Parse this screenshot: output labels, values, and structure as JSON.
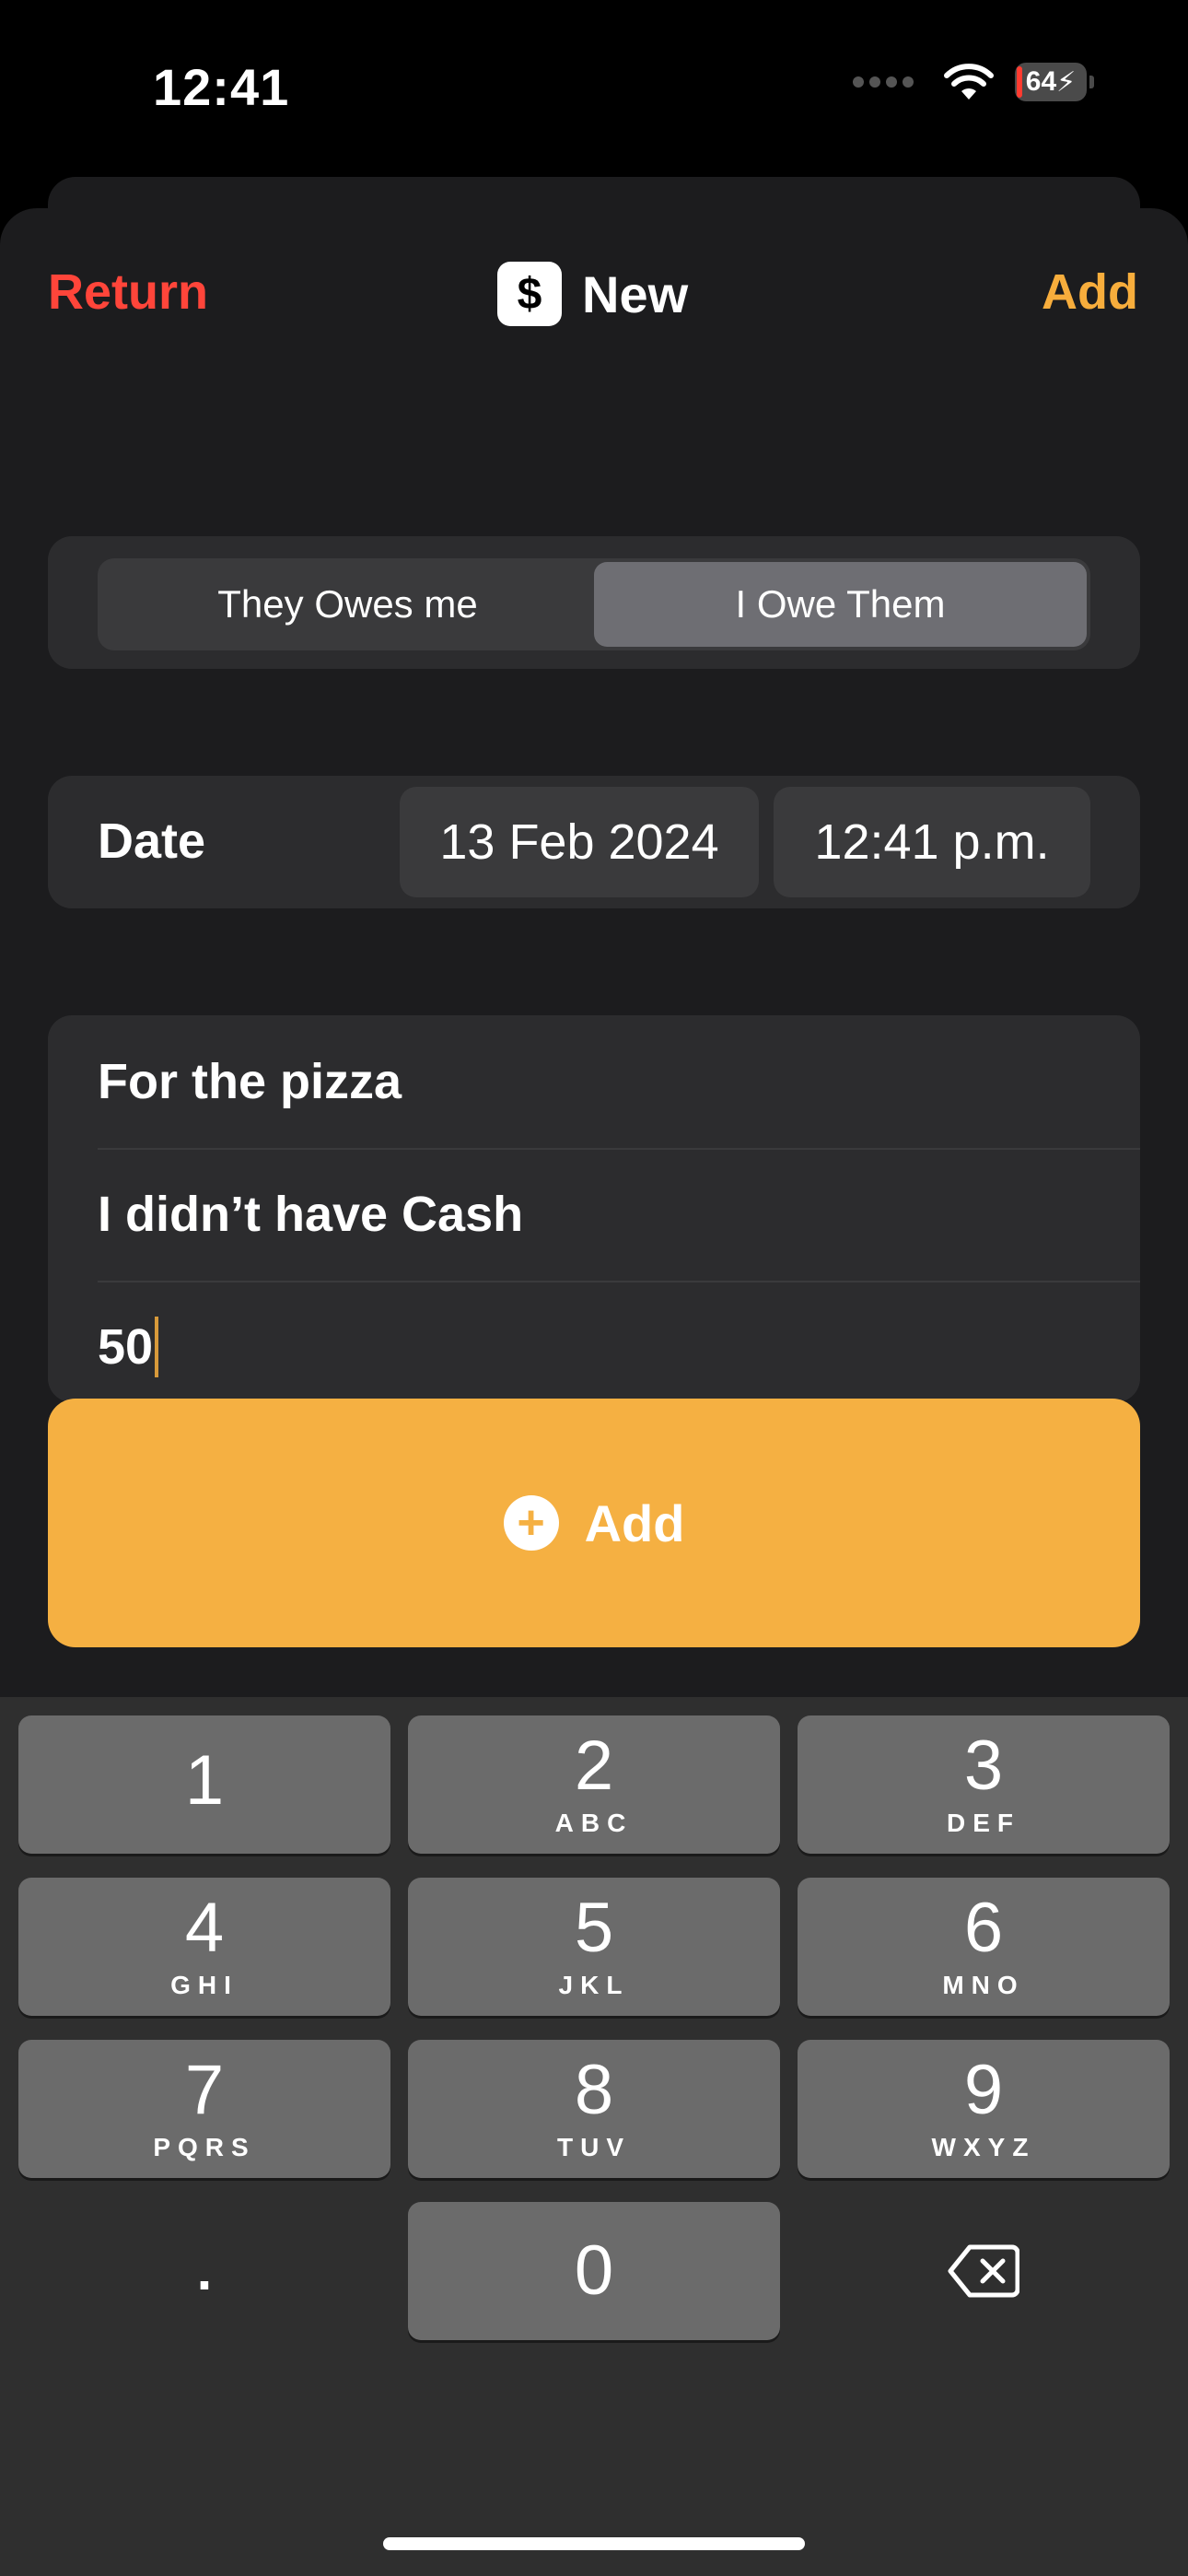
{
  "status_bar": {
    "time": "12:41",
    "battery": "64"
  },
  "nav": {
    "return_label": "Return",
    "title": "New",
    "title_icon": "$",
    "add_label": "Add"
  },
  "segment": {
    "options": [
      "They Owes me",
      "I Owe Them"
    ],
    "selected": "I Owe Them"
  },
  "date_row": {
    "label": "Date",
    "date": "13 Feb 2024",
    "time": "12:41 p.m."
  },
  "form": {
    "title": "For the pizza",
    "note": "I didn’t have Cash",
    "amount": "50"
  },
  "add_button": {
    "label": "Add"
  },
  "keyboard": {
    "keys": [
      {
        "num": "1",
        "letters": ""
      },
      {
        "num": "2",
        "letters": "ABC"
      },
      {
        "num": "3",
        "letters": "DEF"
      },
      {
        "num": "4",
        "letters": "GHI"
      },
      {
        "num": "5",
        "letters": "JKL"
      },
      {
        "num": "6",
        "letters": "MNO"
      },
      {
        "num": "7",
        "letters": "PQRS"
      },
      {
        "num": "8",
        "letters": "TUV"
      },
      {
        "num": "9",
        "letters": "WXYZ"
      },
      {
        "num": "0",
        "letters": ""
      }
    ],
    "decimal": "."
  },
  "colors": {
    "accent": "#f5b042",
    "return": "#ff453a",
    "background": "#1c1c1e"
  }
}
